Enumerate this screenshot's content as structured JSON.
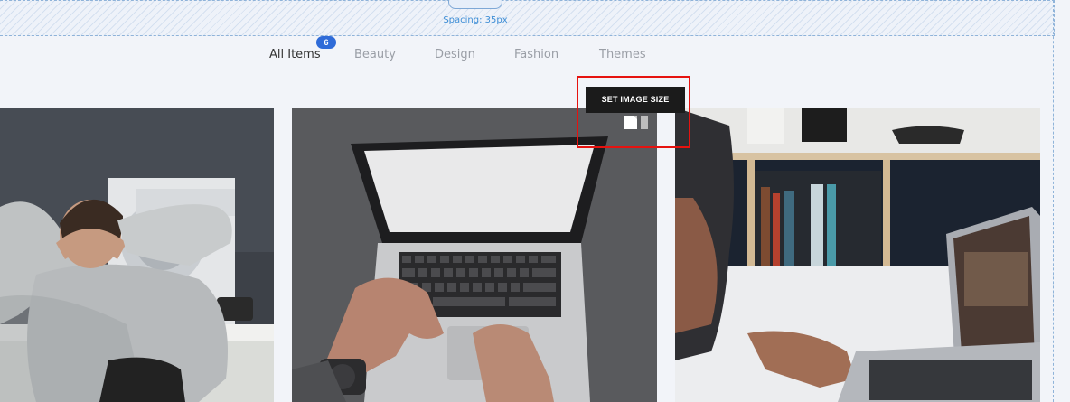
{
  "spacing": {
    "handle_label": "•••",
    "label": "Spacing: 35px"
  },
  "filters": {
    "items": [
      {
        "label": "All Items"
      },
      {
        "label": "Beauty"
      },
      {
        "label": "Design"
      },
      {
        "label": "Fashion"
      },
      {
        "label": "Themes"
      }
    ],
    "active_index": 0,
    "count_badge": "6"
  },
  "tooltip": {
    "label": "SET IMAGE SIZE"
  },
  "colors": {
    "accent": "#2f6bd8",
    "highlight": "#e6120f",
    "spacing_text": "#3e8ed6"
  }
}
